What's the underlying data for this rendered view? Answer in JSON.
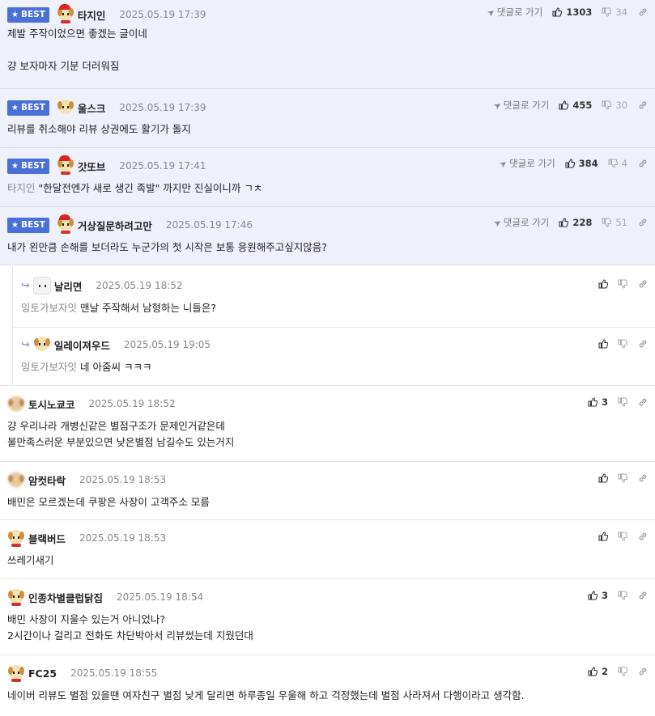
{
  "labels": {
    "best": "BEST",
    "goto_comment": "댓글로 가기"
  },
  "comments": [
    {
      "nick": "타지인",
      "time": "2025.05.19 17:39",
      "up": "1303",
      "down": "34",
      "lines": [
        "제발 주작이었으면 좋겠는 글이네",
        "",
        "걍 보자마자 기분 더러워짐"
      ]
    },
    {
      "nick": "울스크",
      "time": "2025.05.19 17:39",
      "up": "455",
      "down": "30",
      "lines": [
        "리뷰를 취소해야 리뷰 상권에도 활기가 돌지"
      ]
    },
    {
      "nick": "갓또브",
      "time": "2025.05.19 17:41",
      "up": "384",
      "down": "4",
      "mention": "타지인",
      "lines": [
        "\"한달전엔가 새로 생긴 족발\" 까지만 진실이니까 ㄱㅊ"
      ]
    },
    {
      "nick": "거상질문하려고만",
      "time": "2025.05.19 17:46",
      "up": "228",
      "down": "51",
      "lines": [
        "내가 왼만큼 손해를 보더라도 누군가의 첫 시작은 보통 응원해주고싶지않음?"
      ]
    },
    {
      "nick": "날리면",
      "time": "2025.05.19 18:52",
      "mention": "잉토가보자잇",
      "lines": [
        "맨날 주작해서 남형하는 니들은?"
      ]
    },
    {
      "nick": "일레이져우드",
      "time": "2025.05.19 19:05",
      "mention": "잉토가보자잇",
      "lines": [
        "네 아줌씨 ㅋㅋㅋ"
      ]
    },
    {
      "nick": "토시노쿄코",
      "time": "2025.05.19 18:52",
      "up": "3",
      "lines": [
        "걍 우리나라 개병신같은 별점구조가 문제인거같은데",
        "불만족스러운 부분있으면 낮은별점 남길수도 있는거지"
      ]
    },
    {
      "nick": "암컷타락",
      "time": "2025.05.19 18:53",
      "lines": [
        "배민은 모르겠는데 쿠팡은 사장이 고객주소 모름"
      ]
    },
    {
      "nick": "블랙버드",
      "time": "2025.05.19 18:53",
      "lines": [
        "쓰레기새기"
      ]
    },
    {
      "nick": "인종차별클럽닭집",
      "time": "2025.05.19 18:54",
      "up": "3",
      "lines": [
        "배민 사장이 지울수 있는거 아니었나?",
        "2시간이나 걸리고 전화도 차단박아서 리뷰썼는데 지웠던대"
      ]
    },
    {
      "nick": "FC25",
      "time": "2025.05.19 18:55",
      "up": "2",
      "lines": [
        "네이버 리뷰도 별점 있을땐 여자친구 별점 낮게 달리면 하루종일 우울해 하고 걱정했는데 별점 사라져서 다행이라고 생각함."
      ]
    }
  ]
}
